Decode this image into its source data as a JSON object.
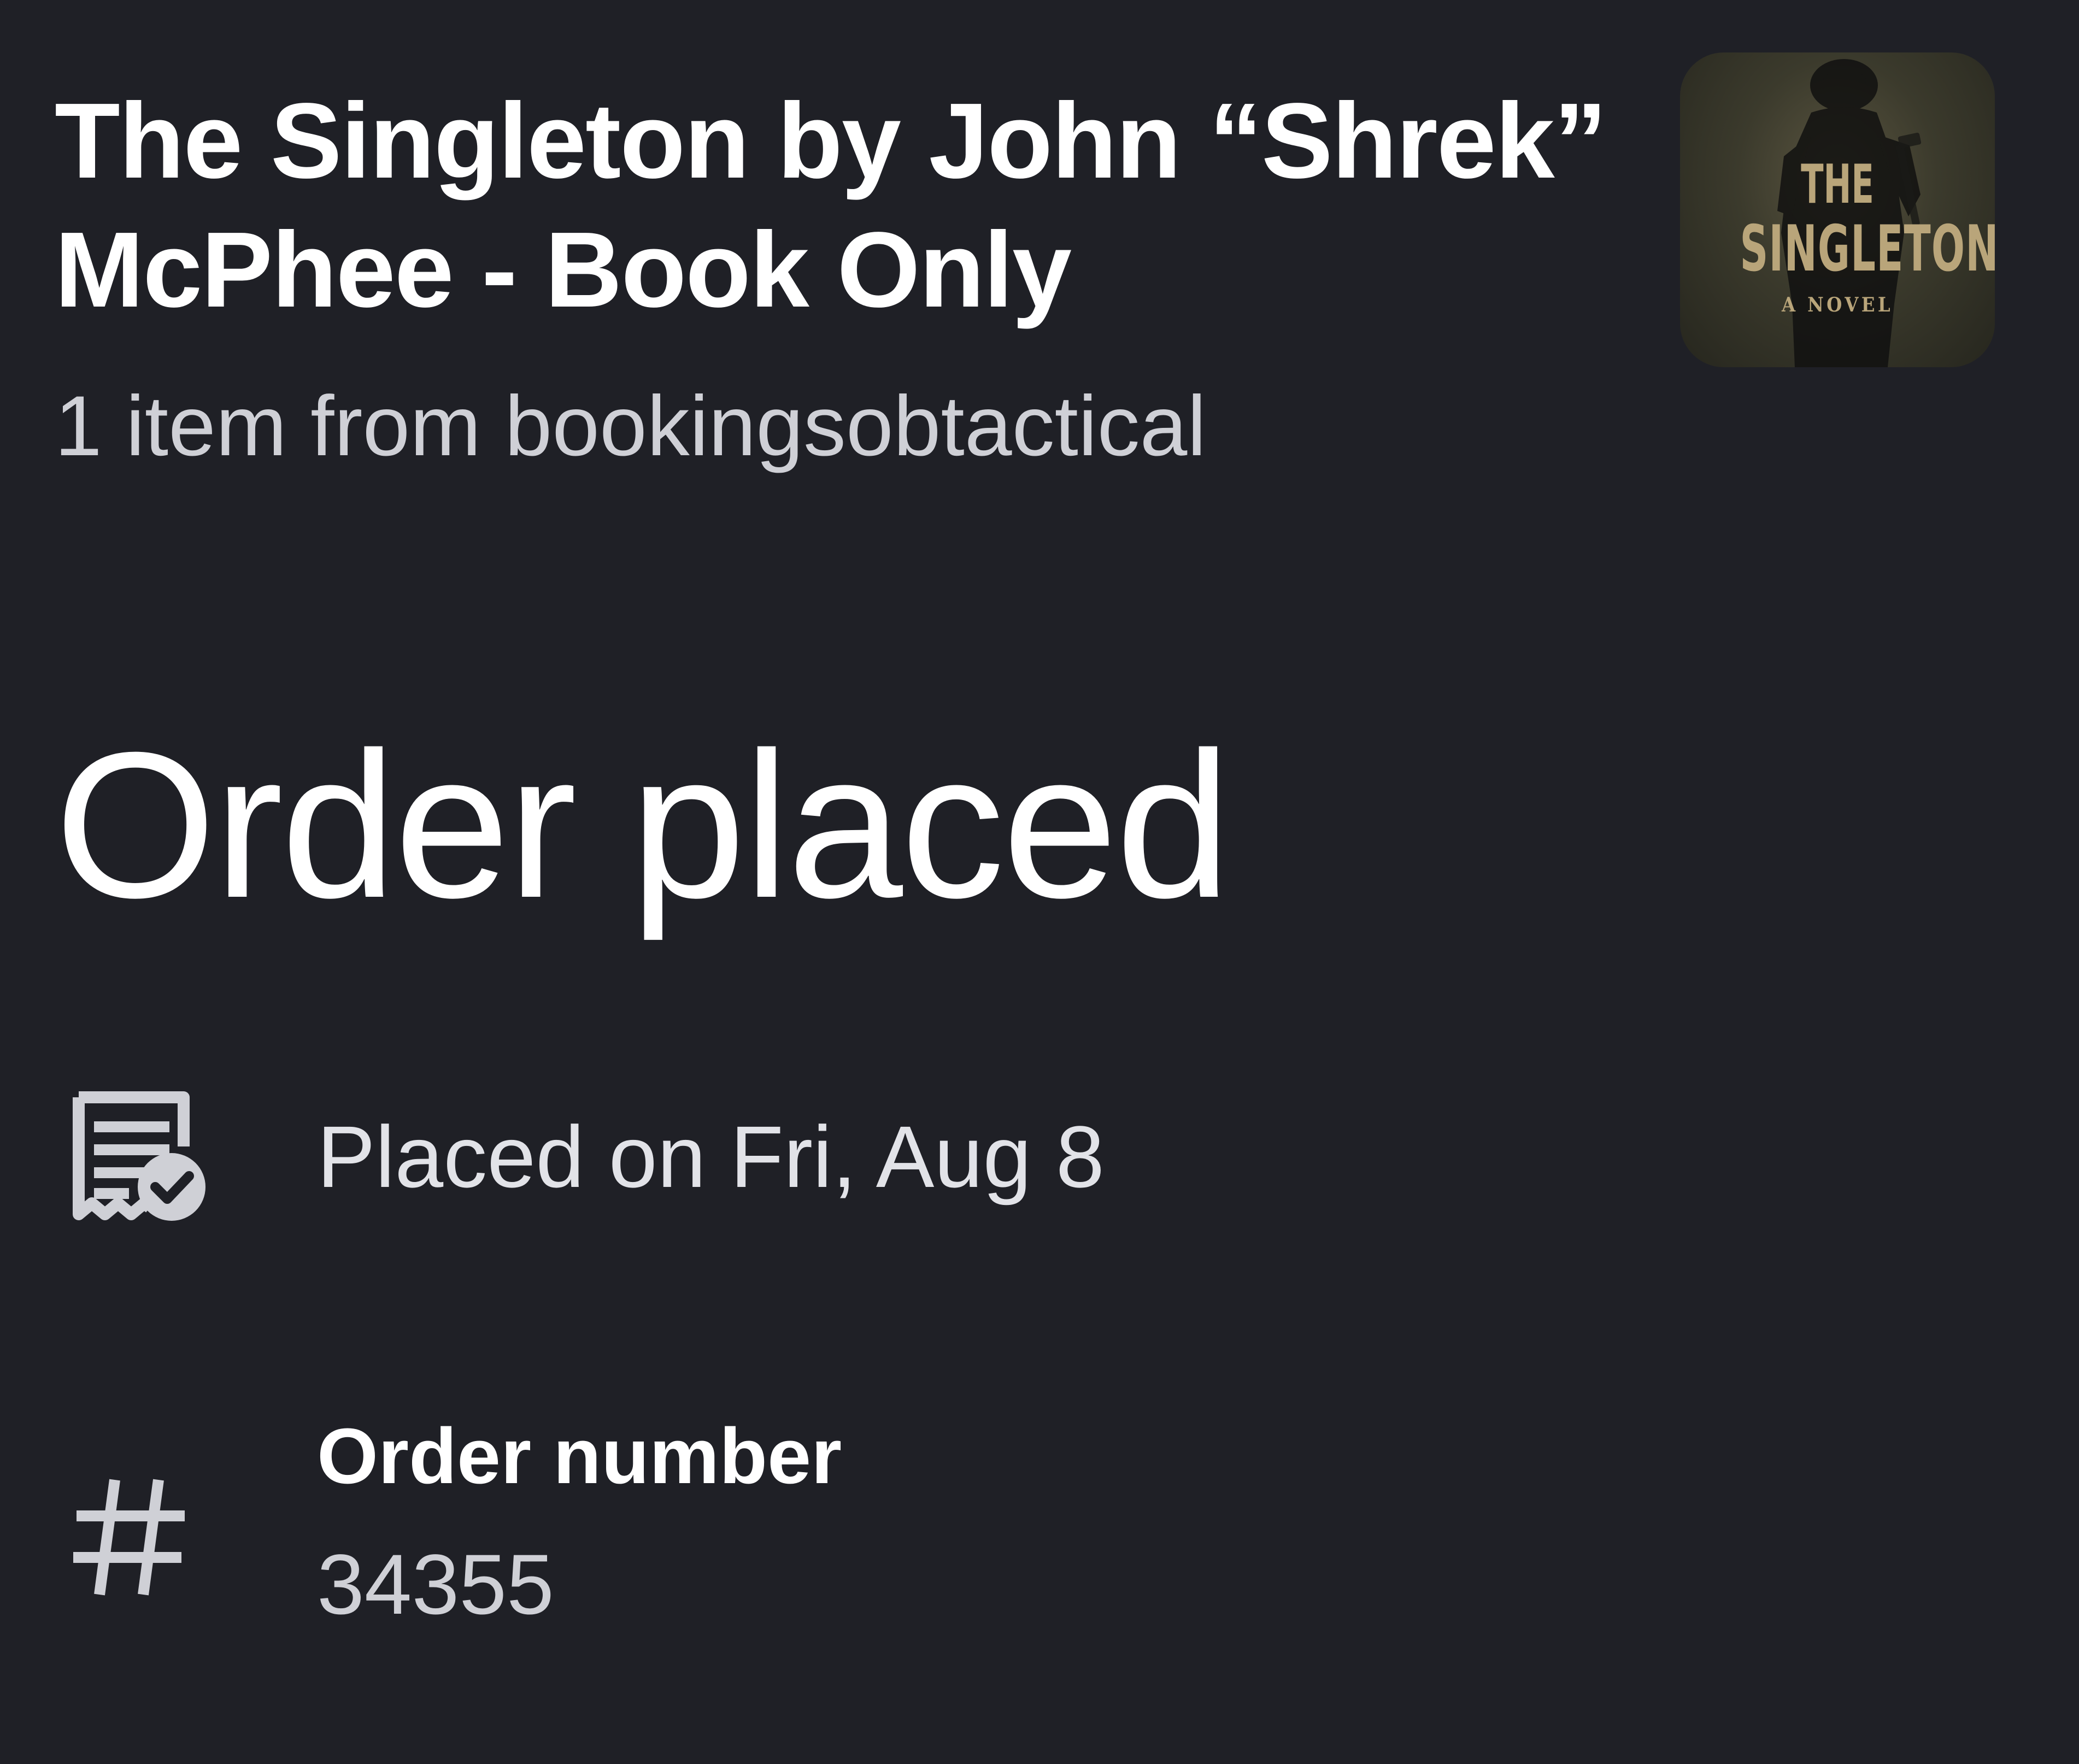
{
  "product": {
    "title": "The Singleton by John “Shrek” McPhee - Book Only",
    "seller_line": "1 item from bookingsobtactical",
    "cover": {
      "line1": "THE",
      "line2": "SINGLETON",
      "line3": "A NOVEL"
    }
  },
  "order": {
    "status": "Order placed",
    "placed_on": "Placed on Fri, Aug 8",
    "number_label": "Order number",
    "number_value": "34355"
  },
  "icons": {
    "receipt": "receipt-check-icon",
    "hash": "hash-icon"
  },
  "colors": {
    "background": "#1f2026",
    "primary_text": "#ffffff",
    "secondary_text": "#cfd0d6",
    "icon": "#cfd0d6",
    "cover_text": "#b9a57a"
  }
}
